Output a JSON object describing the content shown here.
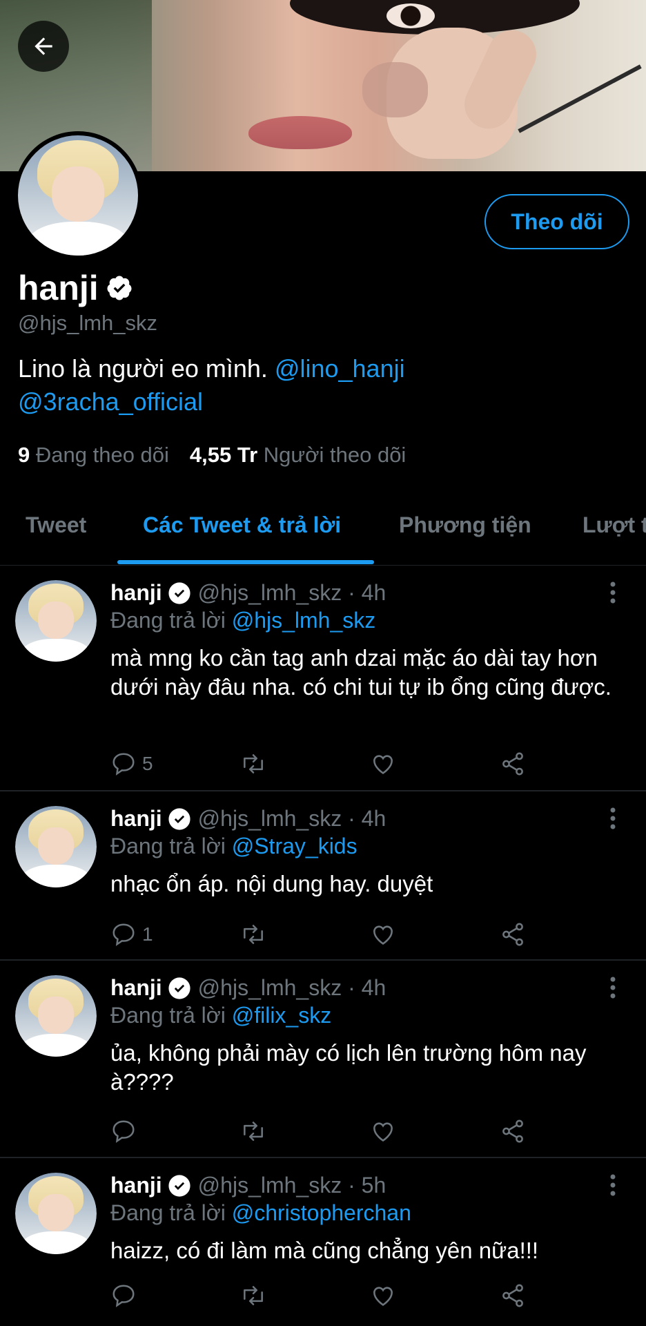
{
  "header": {
    "back_label": "back"
  },
  "profile": {
    "name": "hanji",
    "handle": "@hjs_lmh_skz",
    "bio_text": "Lino là người eo mình. ",
    "bio_mentions": [
      "@lino_hanji",
      "@3racha_official"
    ],
    "follow_label": "Theo dõi",
    "following_count": "9",
    "following_label": "Đang theo dõi",
    "followers_count": "4,55 Tr",
    "followers_label": "Người theo dõi"
  },
  "tabs": [
    {
      "label": "Tweet",
      "active": false
    },
    {
      "label": "Các Tweet & trả lời",
      "active": true
    },
    {
      "label": "Phương tiện",
      "active": false
    },
    {
      "label": "Lượt t",
      "active": false
    }
  ],
  "tweets": [
    {
      "name": "hanji",
      "meta": "@hjs_lmh_skz · 4h",
      "reply_prefix": "Đang trả lời ",
      "reply_to": "@hjs_lmh_skz",
      "text": "mà mng ko cần tag anh dzai mặc áo dài tay hơn dưới này đâu nha. có chi tui tự ib ổng cũng được.",
      "reply_count": "5"
    },
    {
      "name": "hanji",
      "meta": "@hjs_lmh_skz · 4h",
      "reply_prefix": "Đang trả lời ",
      "reply_to": "@Stray_kids",
      "text": "nhạc ổn áp. nội dung hay. duyệt",
      "reply_count": "1"
    },
    {
      "name": "hanji",
      "meta": "@hjs_lmh_skz · 4h",
      "reply_prefix": "Đang trả lời ",
      "reply_to": "@filix_skz",
      "text": "ủa, không phải mày có lịch lên trường hôm nay à????",
      "reply_count": ""
    },
    {
      "name": "hanji",
      "meta": "@hjs_lmh_skz · 5h",
      "reply_prefix": "Đang trả lời ",
      "reply_to": "@christopherchan",
      "text": "haizz, có đi làm mà cũng chẳng yên nữa!!!",
      "reply_count": ""
    }
  ],
  "colors": {
    "accent": "#1d9bf0",
    "muted": "#6e767d",
    "background": "#000000",
    "divider": "#1f2327"
  },
  "icons": [
    "back-arrow-icon",
    "verified-badge-icon",
    "more-vertical-icon",
    "reply-icon",
    "retweet-icon",
    "like-icon",
    "share-icon"
  ]
}
